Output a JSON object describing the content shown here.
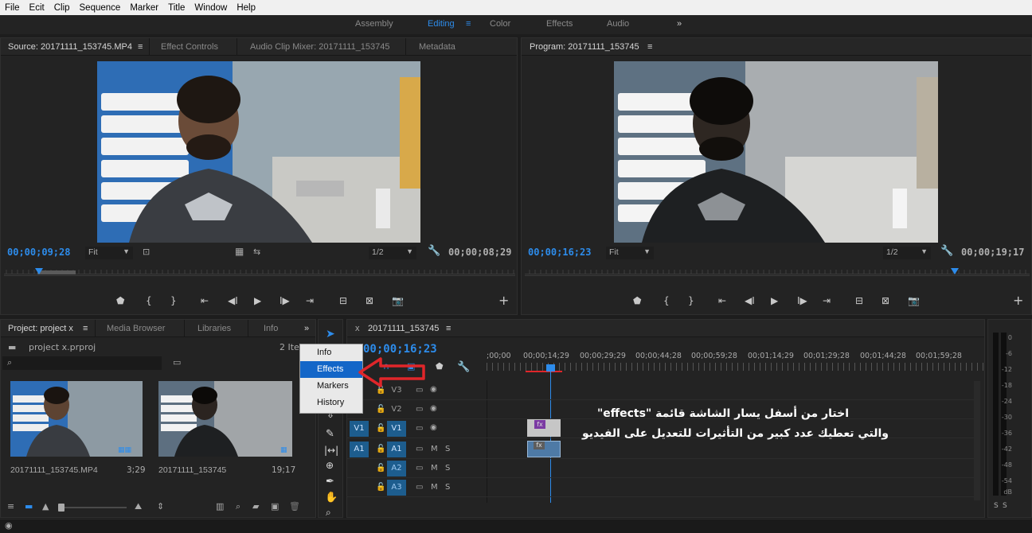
{
  "menu": [
    "File",
    "Ecit",
    "Clip",
    "Sequence",
    "Marker",
    "Title",
    "Window",
    "Help"
  ],
  "workspaces": {
    "items": [
      "Assembly",
      "Editing",
      "Color",
      "Effects",
      "Audio"
    ],
    "active": "Editing",
    "overflow": "»"
  },
  "source": {
    "tabs": [
      "Source: 20171111_153745.MP4",
      "Effect Controls",
      "Audio Clip Mixer: 20171111_153745",
      "Metadata"
    ],
    "timecode_in": "00;00;09;28",
    "fit": "Fit",
    "quality": "1/2",
    "timecode_dur": "00;00;08;29"
  },
  "program": {
    "tab": "Program: 20171111_153745",
    "timecode_in": "00;00;16;23",
    "fit": "Fit",
    "quality": "1/2",
    "timecode_dur": "00;00;19;17"
  },
  "project": {
    "tabs": [
      "Project: project x",
      "Media Browser",
      "Libraries",
      "Info"
    ],
    "filename": "project x.prproj",
    "items_count": "2 Iten",
    "clips": [
      {
        "name": "20171111_153745.MP4",
        "duration": "3;29"
      },
      {
        "name": "20171111_153745",
        "duration": "19;17"
      }
    ]
  },
  "popup_menu": {
    "items": [
      "Info",
      "Effects",
      "Markers",
      "History"
    ],
    "selected": "Effects"
  },
  "timeline": {
    "tab": "20171111_153745",
    "timecode": "00;00;16;23",
    "ruler_labels": [
      ";00;00",
      "00;00;14;29",
      "00;00;29;29",
      "00;00;44;28",
      "00;00;59;28",
      "00;01;14;29",
      "00;01;29;28",
      "00;01;44;28",
      "00;01;59;28"
    ],
    "video_tracks": [
      "V3",
      "V2",
      "V1"
    ],
    "audio_tracks": [
      "A1",
      "A2",
      "A3"
    ],
    "src_v": "V1",
    "src_a": "A1",
    "m_label": "M",
    "s_label": "S",
    "fx_label": "fx"
  },
  "annotation": {
    "line1": "اختار من أسفل يسار الشاشة قائمة  \"effects\"",
    "line2": "والتي تعطيك عدد كبير من التأثيرات  للتعديل على الفيديو"
  },
  "meter": {
    "scale": [
      "0",
      "-6",
      "-12",
      "-18",
      "-24",
      "-30",
      "-36",
      "-42",
      "-48",
      "-54",
      "dB"
    ],
    "bottom": [
      "S",
      "S"
    ]
  },
  "colors": {
    "accent": "#2d8ceb",
    "arrow": "#e0262a",
    "panel_bg": "#232323"
  }
}
